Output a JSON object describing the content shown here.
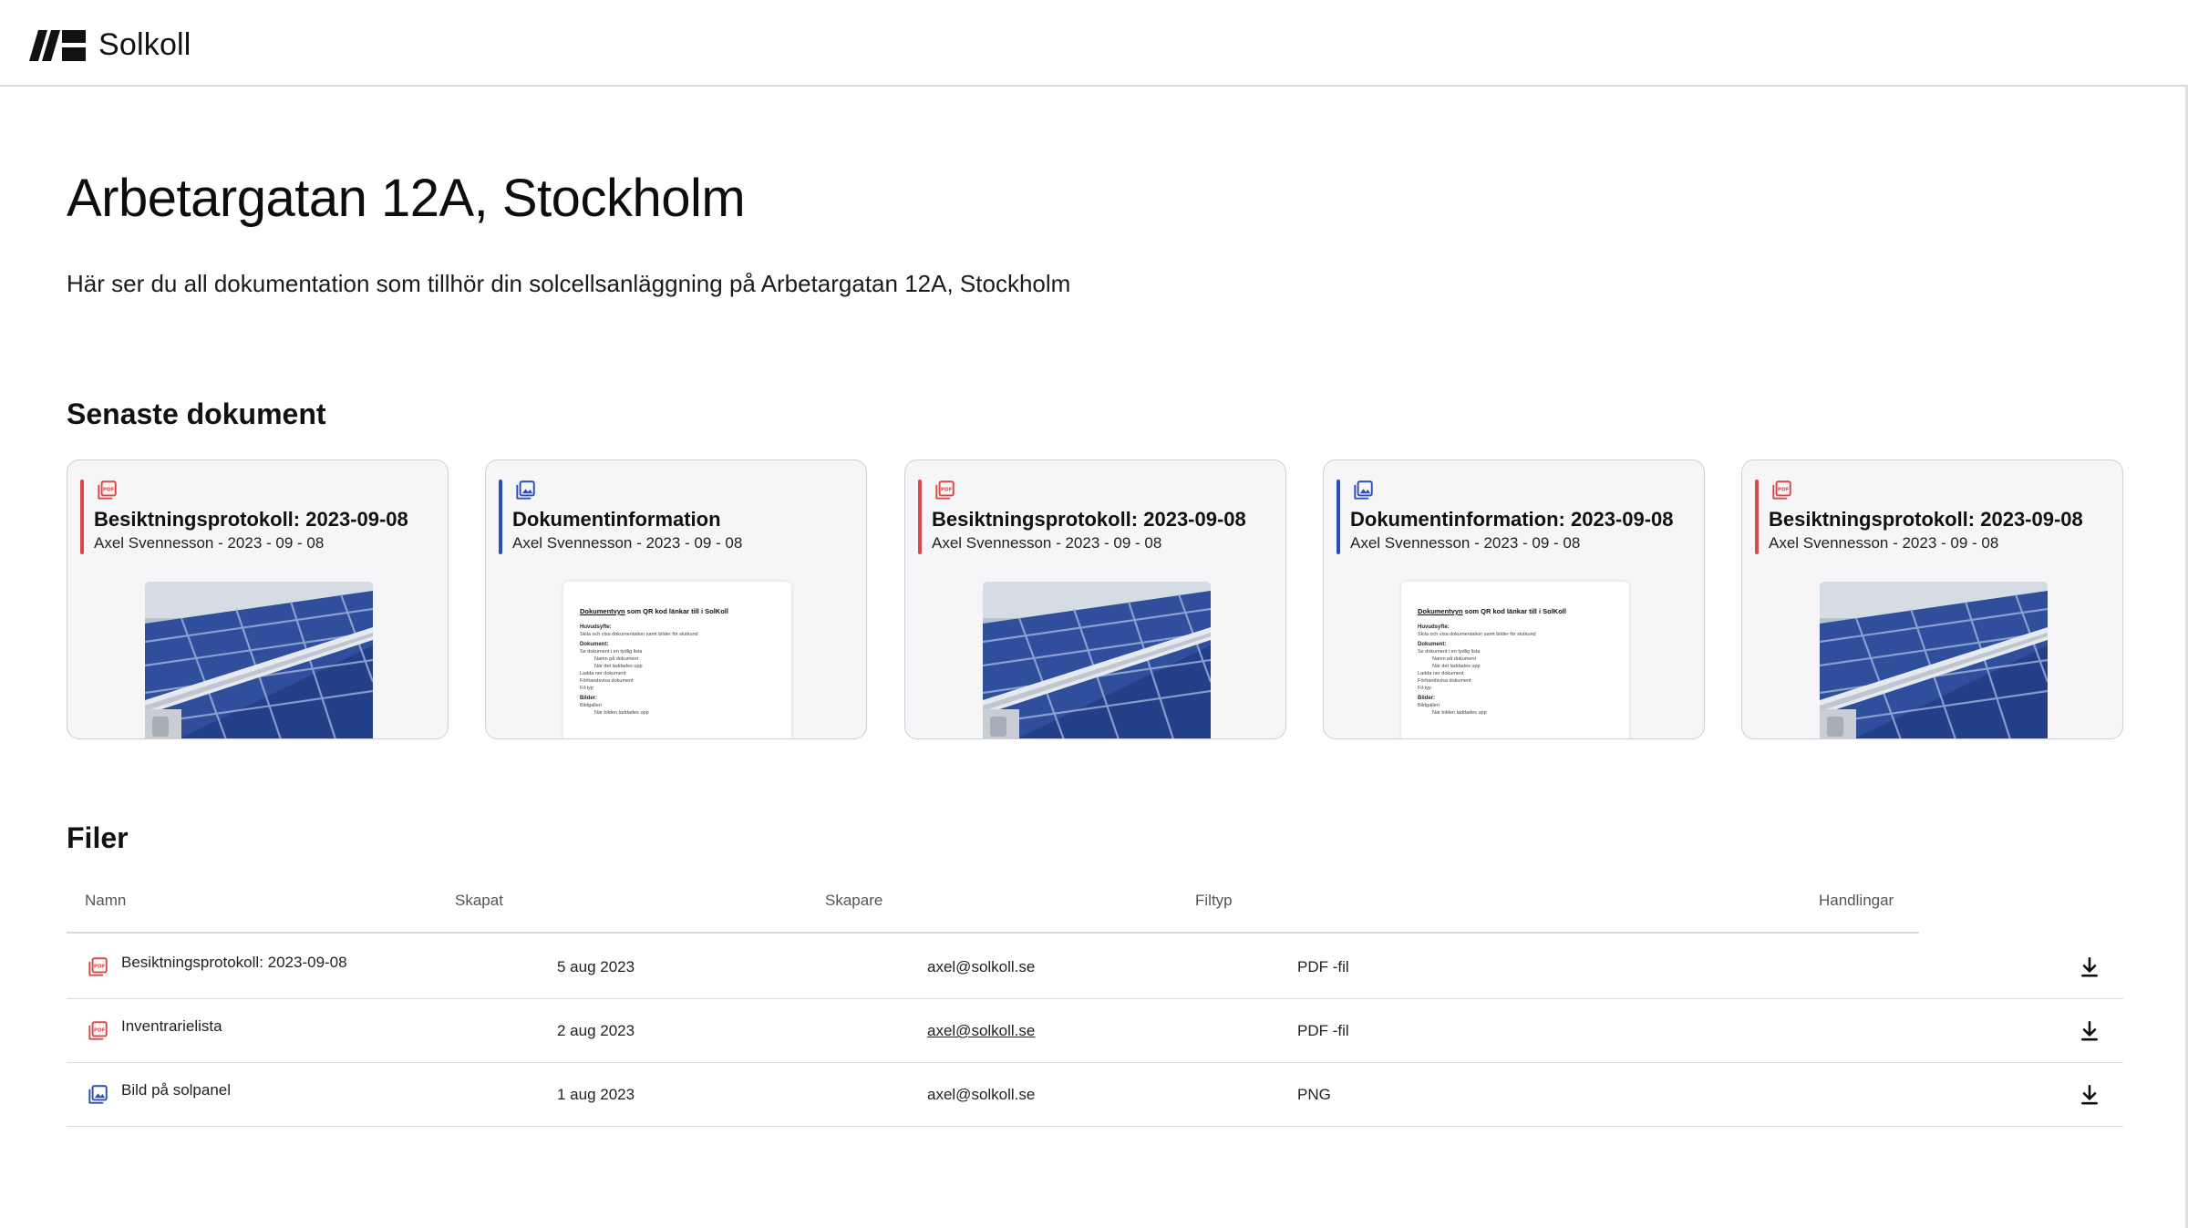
{
  "brand": {
    "name": "Solkoll"
  },
  "page": {
    "title": "Arbetargatan 12A, Stockholm",
    "description": "Här ser du all dokumentation som tillhör din solcellsanläggning på Arbetargatan 12A, Stockholm"
  },
  "recent": {
    "heading": "Senaste dokument",
    "cards": [
      {
        "title": "Besiktningsprotokoll: 2023-09-08",
        "subtitle": "Axel Svennesson - 2023 - 09 - 08",
        "icon": "pdf-file-icon",
        "thumbnail": "solar-panel-photo"
      },
      {
        "title": "Dokumentinformation",
        "subtitle": "Axel Svennesson - 2023 - 09 - 08",
        "icon": "image-file-icon",
        "thumbnail": "document-page"
      },
      {
        "title": "Besiktningsprotokoll: 2023-09-08",
        "subtitle": "Axel Svennesson - 2023 - 09 - 08",
        "icon": "pdf-file-icon",
        "thumbnail": "solar-panel-photo"
      },
      {
        "title": "Dokumentinformation: 2023-09-08",
        "subtitle": "Axel Svennesson - 2023 - 09 - 08",
        "icon": "image-file-icon",
        "thumbnail": "document-page"
      },
      {
        "title": "Besiktningsprotokoll: 2023-09-08",
        "subtitle": "Axel Svennesson - 2023 - 09 - 08",
        "icon": "pdf-file-icon",
        "thumbnail": "solar-panel-photo"
      }
    ]
  },
  "doc_preview": {
    "heading_underlined": "Dokumentvyn",
    "heading_rest": " som QR kod länkar till i SolKoll",
    "purpose_label": "Huvudsyfte:",
    "purpose_text": "Skila och visa dokumentation samt bilder för slutkund",
    "docs_label": "Dokument:",
    "docs_lines": [
      "Se dokument i en tydlig lista",
      "Namn på dokument",
      "När det laddades upp",
      "Ladda ner dokument",
      "Förhandsvisa dokument",
      "Fil-typ"
    ],
    "images_label": "Bilder:",
    "images_lines": [
      "Bildgalleri",
      "När bilden laddades upp"
    ]
  },
  "files": {
    "heading": "Filer",
    "columns": {
      "name": "Namn",
      "created": "Skapat",
      "creator": "Skapare",
      "type": "Filtyp",
      "actions": "Handlingar"
    },
    "rows": [
      {
        "name": "Besiktningsprotokoll: 2023-09-08",
        "created": "5 aug 2023",
        "creator": "axel@solkoll.se",
        "type": "PDF -fil",
        "icon": "pdf-file-icon",
        "action_icon": "download-icon"
      },
      {
        "name": "Inventrarielista",
        "created": "2 aug 2023",
        "creator": "axel@solkoll.se",
        "type": "PDF -fil",
        "icon": "pdf-file-icon",
        "action_icon": "download-icon"
      },
      {
        "name": "Bild på solpanel",
        "created": "1 aug 2023",
        "creator": "axel@solkoll.se",
        "type": "PNG",
        "icon": "image-file-icon",
        "action_icon": "download-icon"
      }
    ]
  },
  "colors": {
    "pdf_accent": "#d84a4a",
    "image_accent": "#2d4fb3",
    "card_background": "#f6f6f8",
    "divider": "#d9d9d9"
  }
}
